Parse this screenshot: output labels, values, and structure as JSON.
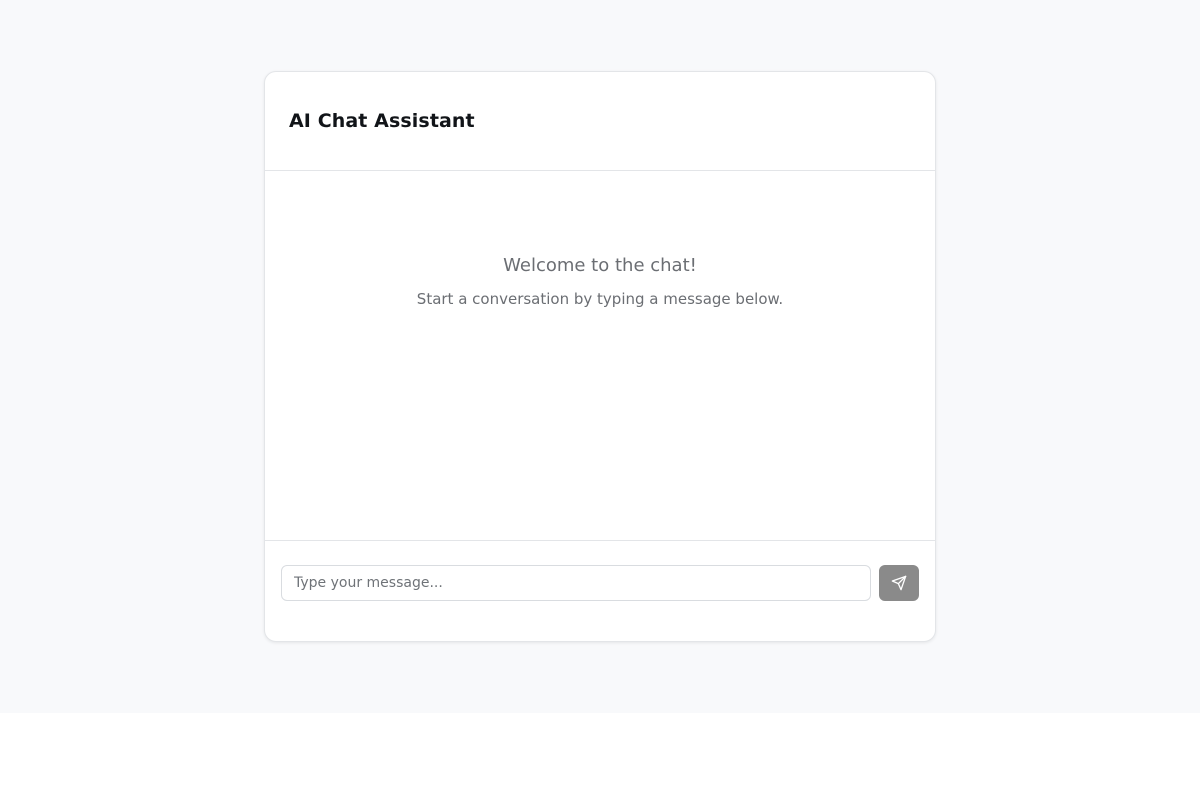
{
  "header": {
    "title": "AI Chat Assistant"
  },
  "chat": {
    "welcome_title": "Welcome to the chat!",
    "welcome_subtitle": "Start a conversation by typing a message below."
  },
  "composer": {
    "input_value": "",
    "input_placeholder": "Type your message...",
    "send_icon": "send-icon",
    "send_button_color": "#8a8a8a"
  },
  "colors": {
    "page_background": "#f8f9fb",
    "card_background": "#ffffff",
    "border": "#e3e5e8",
    "title_text": "#111418",
    "muted_text": "#6b6e73"
  }
}
